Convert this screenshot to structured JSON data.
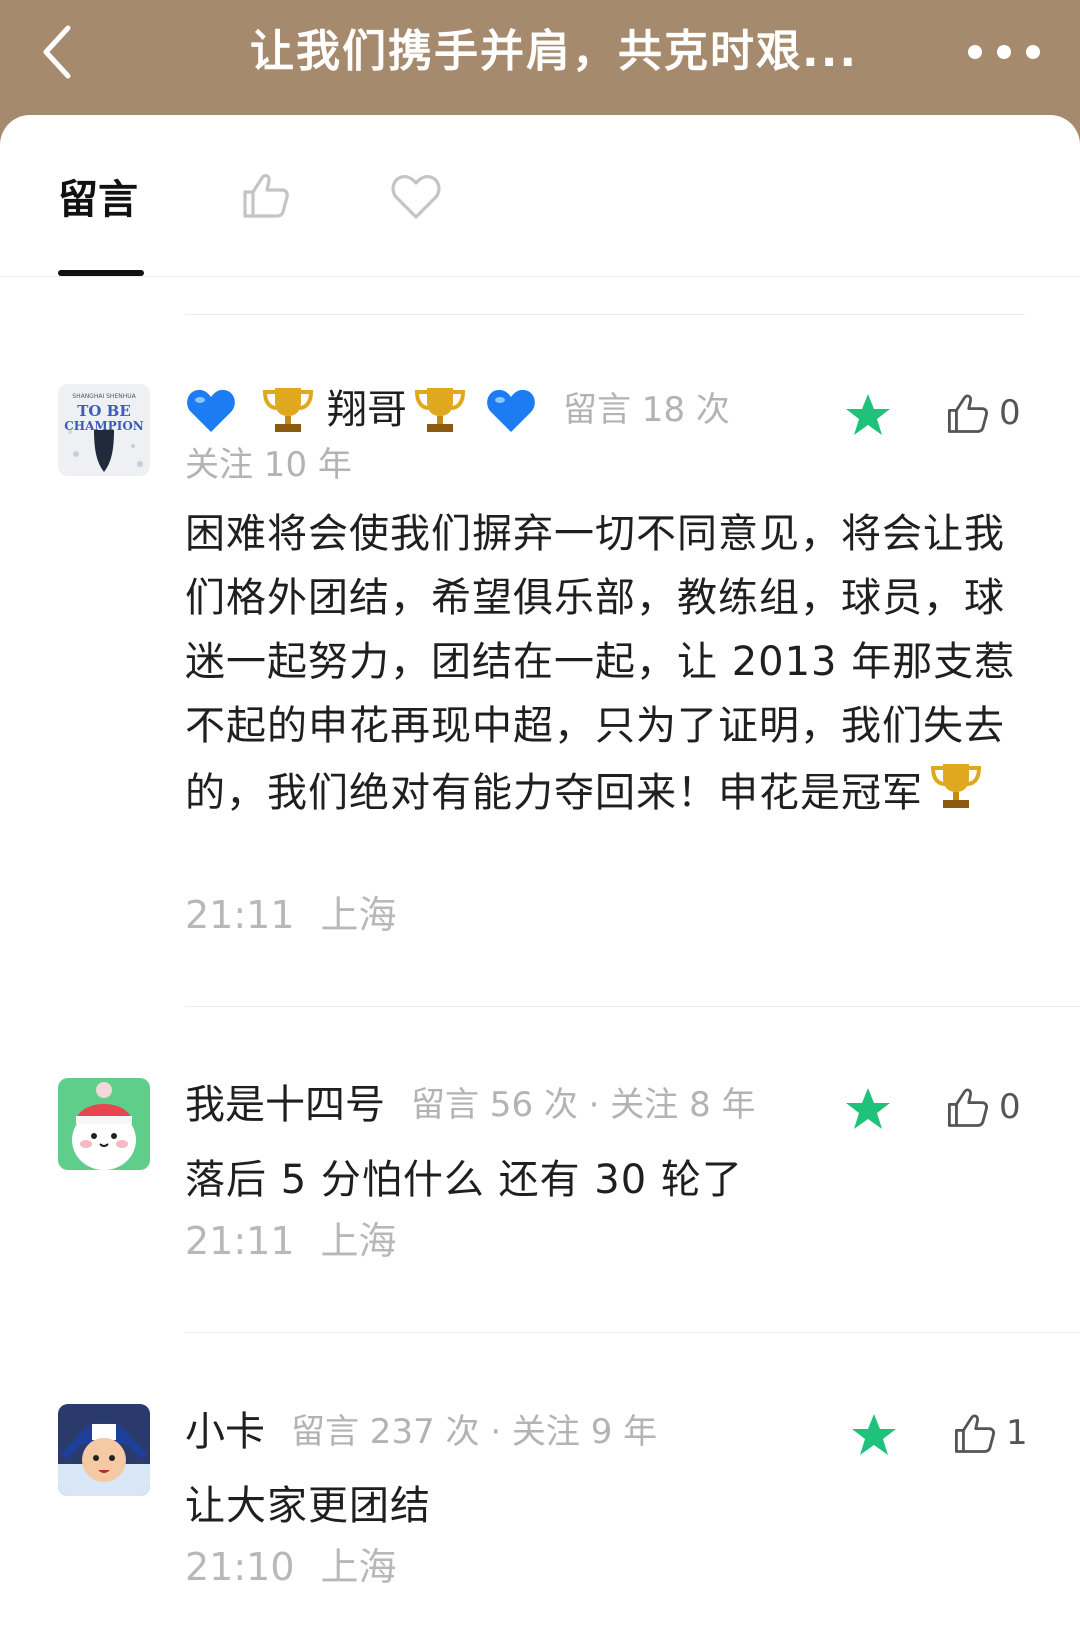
{
  "header": {
    "title": "让我们携手并肩，共克时艰..."
  },
  "tabs": {
    "message_label": "留言"
  },
  "comments": [
    {
      "username": "翔哥",
      "meta": "留言 18 次",
      "follow": "关注 10 年",
      "text": "困难将会使我们摒弃一切不同意见，将会让我们格外团结，希望俱乐部，教练组，球员，球迷一起努力，团结在一起，让 2013 年那支惹不起的申花再现中超，只为了证明，我们失去的，我们绝对有能力夺回来！申花是冠军",
      "time": "21:11",
      "location": "上海",
      "likes": "0",
      "avatar_text": [
        "SHANGHAI SHENHUA",
        "TO BE",
        "CHAMPION"
      ]
    },
    {
      "username": "我是十四号",
      "meta": "留言 56 次 · 关注 8 年",
      "text": "落后 5 分怕什么 还有 30 轮了",
      "time": "21:11",
      "location": "上海",
      "likes": "0"
    },
    {
      "username": "小卡",
      "meta": "留言 237 次 · 关注 9 年",
      "text": "让大家更团结",
      "time": "21:10",
      "location": "上海",
      "likes": "1"
    }
  ],
  "colors": {
    "header_bg": "#a68a6d",
    "star_green": "#1ec27a",
    "heart_blue": "#1d7cf2",
    "trophy_gold": "#e0a81e"
  },
  "icons": [
    "back-arrow-icon",
    "more-icon",
    "thumbs-up-icon",
    "heart-outline-icon",
    "star-icon",
    "blue-heart-icon",
    "trophy-icon"
  ]
}
